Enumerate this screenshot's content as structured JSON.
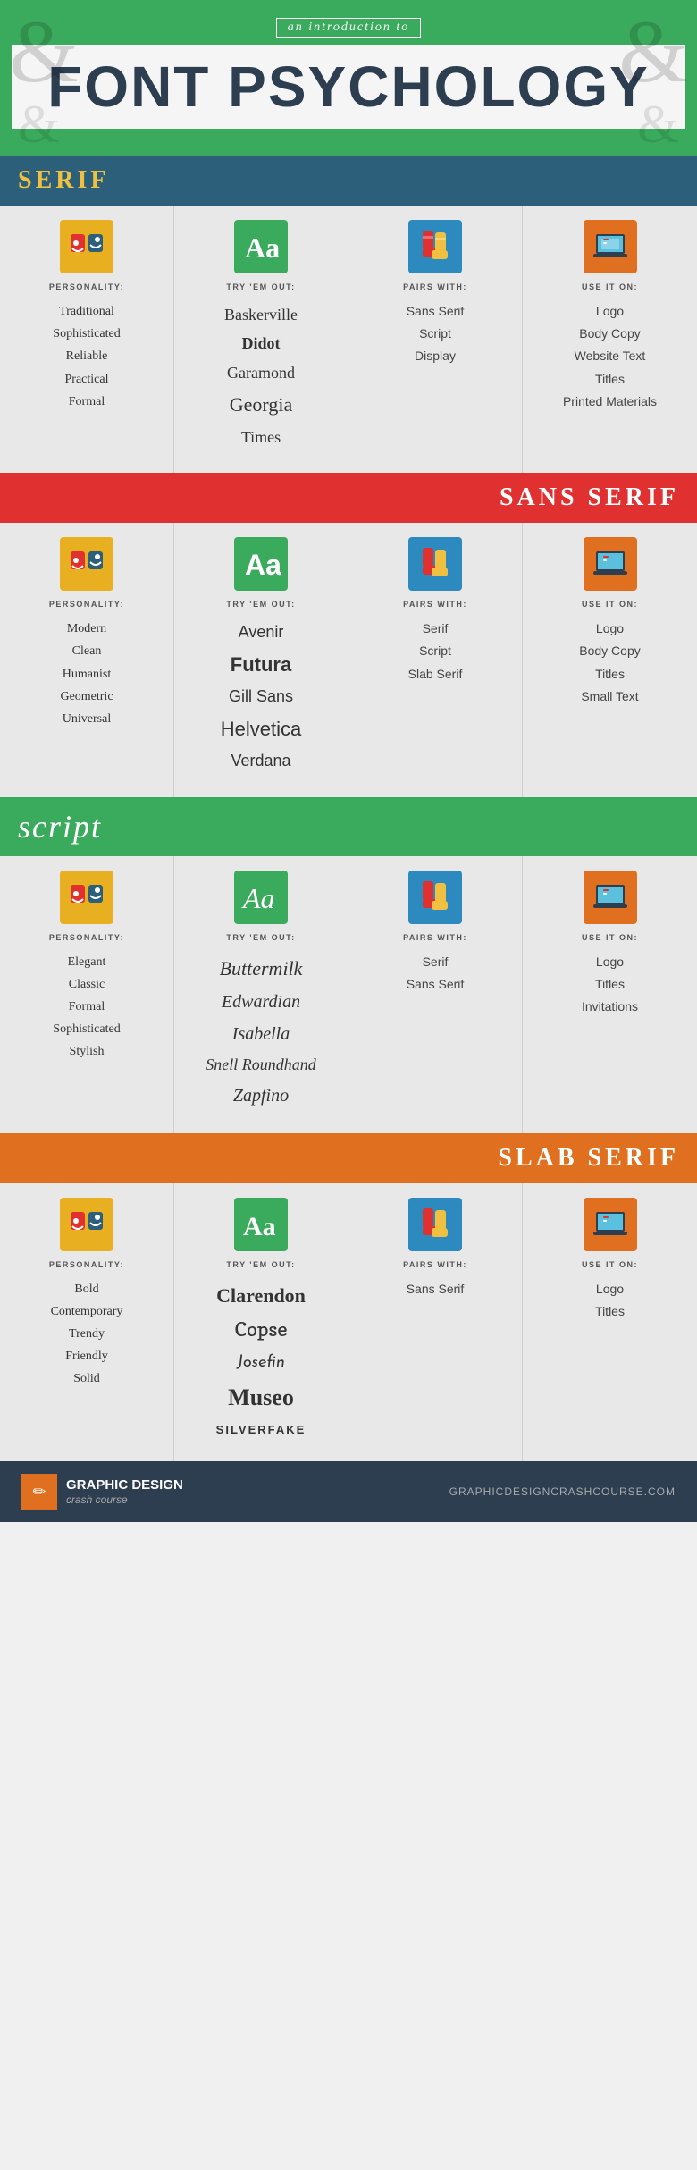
{
  "header": {
    "subtitle": "an introduction to",
    "title": "FONT PSYCHOLOGY",
    "deco_left": "&",
    "deco_right": "&",
    "deco_bl": "&",
    "deco_br": "&"
  },
  "sections": [
    {
      "id": "serif",
      "header_label": "SERIF",
      "header_type": "serif-hdr",
      "personality_label": "PERSONALITY:",
      "tryout_label": "TRY 'EM OUT:",
      "pairs_label": "PAIRS WITH:",
      "useit_label": "USE IT ON:",
      "personality": [
        "Traditional",
        "Sophisticated",
        "Reliable",
        "Practical",
        "Formal"
      ],
      "fonts": [
        "Baskerville",
        "Didot",
        "Garamond",
        "Georgia",
        "Times"
      ],
      "font_classes": [
        "font-baskerville",
        "font-didot",
        "font-garamond",
        "font-georgia",
        "font-times"
      ],
      "pairs": [
        "Sans Serif",
        "Script",
        "Display"
      ],
      "useit": [
        "Logo",
        "Body Copy",
        "Website Text",
        "Titles",
        "Printed Materials"
      ]
    },
    {
      "id": "sans-serif",
      "header_label": "SANS SERIF",
      "header_type": "sans-hdr",
      "personality_label": "PERSONALITY:",
      "tryout_label": "TRY 'EM OUT:",
      "pairs_label": "PAIRS WITH:",
      "useit_label": "USE IT ON:",
      "personality": [
        "Modern",
        "Clean",
        "Humanist",
        "Geometric",
        "Universal"
      ],
      "fonts": [
        "Avenir",
        "Futura",
        "Gill Sans",
        "Helvetica",
        "Verdana"
      ],
      "font_classes": [
        "font-avenir",
        "font-futura",
        "font-gillsans",
        "font-helvetica",
        "font-verdana"
      ],
      "pairs": [
        "Serif",
        "Script",
        "Slab Serif"
      ],
      "useit": [
        "Logo",
        "Body Copy",
        "Titles",
        "Small Text"
      ]
    },
    {
      "id": "script",
      "header_label": "script",
      "header_type": "script-hdr",
      "personality_label": "PERSONALITY:",
      "tryout_label": "TRY 'EM OUT:",
      "pairs_label": "PAIRS WITH:",
      "useit_label": "USE IT ON:",
      "personality": [
        "Elegant",
        "Classic",
        "Formal",
        "Sophisticated",
        "Stylish"
      ],
      "fonts": [
        "Buttermilk",
        "Edwardian",
        "Isabella",
        "Snell Roundhand",
        "Zapfino"
      ],
      "font_classes": [
        "font-buttermilk",
        "font-edwardian",
        "font-isabella",
        "font-snell",
        "font-zapfino"
      ],
      "pairs": [
        "Serif",
        "Sans Serif"
      ],
      "useit": [
        "Logo",
        "Titles",
        "Invitations"
      ]
    },
    {
      "id": "slab-serif",
      "header_label": "SLAB SERIF",
      "header_type": "slab-hdr",
      "personality_label": "PERSONALITY:",
      "tryout_label": "TRY 'EM OUT:",
      "pairs_label": "PAIRS WITH:",
      "useit_label": "USE IT ON:",
      "personality": [
        "Bold",
        "Contemporary",
        "Trendy",
        "Friendly",
        "Solid"
      ],
      "fonts": [
        "Clarendon",
        "Copse",
        "Josefin",
        "Museo",
        "SILVERFAKE"
      ],
      "font_classes": [
        "font-clarendon",
        "font-copse",
        "font-josefin",
        "font-museo",
        "font-silverfake"
      ],
      "pairs": [
        "Sans Serif"
      ],
      "useit": [
        "Logo",
        "Titles"
      ]
    }
  ],
  "footer": {
    "logo_icon": "✏",
    "brand_name": "GRAPHIC DESIGN",
    "brand_sub": "crash course",
    "url": "GRAPHICDESIGNCRASHCOURSE.COM"
  }
}
